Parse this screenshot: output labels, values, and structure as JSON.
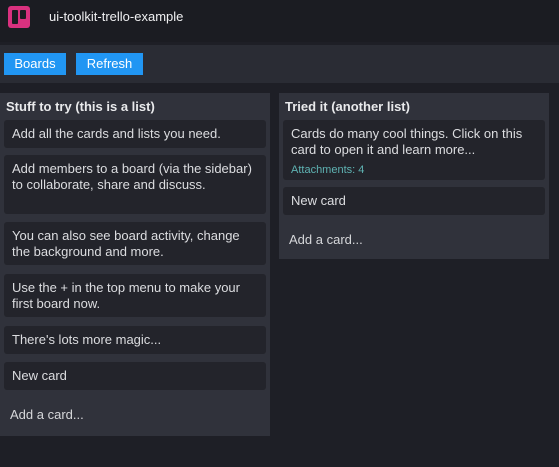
{
  "app": {
    "title": "ui-toolkit-trello-example",
    "logo_icon": "trello-icon",
    "accent": "#d9317f"
  },
  "toolbar": {
    "boards_label": "Boards",
    "refresh_label": "Refresh",
    "button_color": "#2196f3"
  },
  "lists": [
    {
      "title": "Stuff to try (this is a list)",
      "cards": [
        {
          "text": "Add all the cards and lists you need."
        },
        {
          "text": "Add members to a board (via the sidebar) to collaborate, share and discuss."
        },
        {
          "text": "You can also see board activity, change the background and more."
        },
        {
          "text": "Use the + in the top menu to make your first board now."
        },
        {
          "text": "There's lots more magic..."
        },
        {
          "text": "New card"
        }
      ],
      "add_card_label": "Add a card..."
    },
    {
      "title": "Tried it (another list)",
      "cards": [
        {
          "text": "Cards do many cool things. Click on this card to open it and learn more...",
          "meta": "Attachments: 4"
        },
        {
          "text": "New card"
        }
      ],
      "add_card_label": "Add a card..."
    }
  ]
}
